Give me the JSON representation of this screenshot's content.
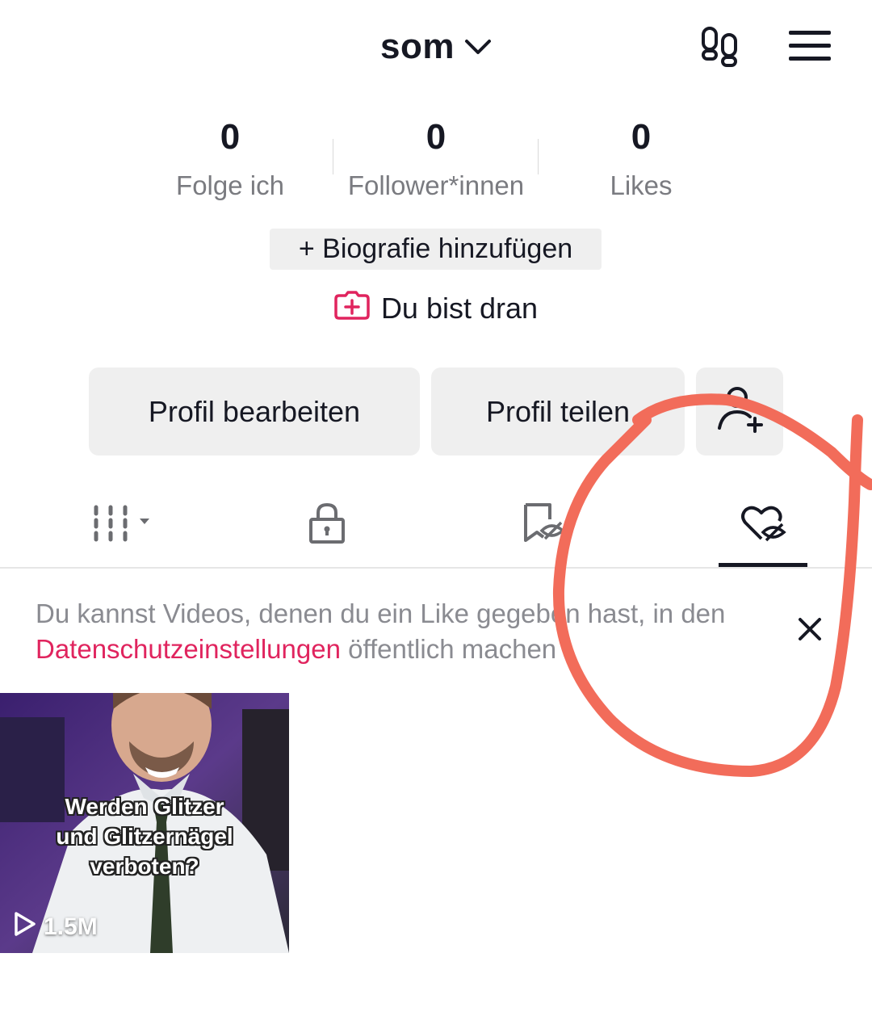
{
  "header": {
    "username": "som",
    "username_icon": "chevron-down-icon",
    "friends_icon": "footprints-icon",
    "menu_icon": "hamburger-menu-icon"
  },
  "stats": [
    {
      "value": "0",
      "label": "Folge ich"
    },
    {
      "value": "0",
      "label": "Follower*innen"
    },
    {
      "value": "0",
      "label": "Likes"
    }
  ],
  "bio_button": "+ Biografie hinzufügen",
  "turn_label": "Du bist dran",
  "actions": {
    "edit": "Profil bearbeiten",
    "share": "Profil teilen",
    "add_friend_icon": "add-person-icon"
  },
  "tabs": [
    {
      "icon": "grid-icon"
    },
    {
      "icon": "lock-icon"
    },
    {
      "icon": "bookmark-hidden-icon"
    },
    {
      "icon": "heart-hidden-icon",
      "active": true
    }
  ],
  "notice": {
    "text_before": "Du kannst Videos, denen du ein Like gegeben hast, in den ",
    "link": "Datenschutzeinstellungen",
    "text_after": " öffentlich machen"
  },
  "videos": [
    {
      "caption_line1": "Werden Glitzer",
      "caption_line2": "und Glitzernägel",
      "caption_line3": "verboten?",
      "views": "1.5M"
    }
  ],
  "colors": {
    "accent": "#e0245e",
    "annotation": "#f26c5a",
    "button_bg": "#efefef"
  }
}
